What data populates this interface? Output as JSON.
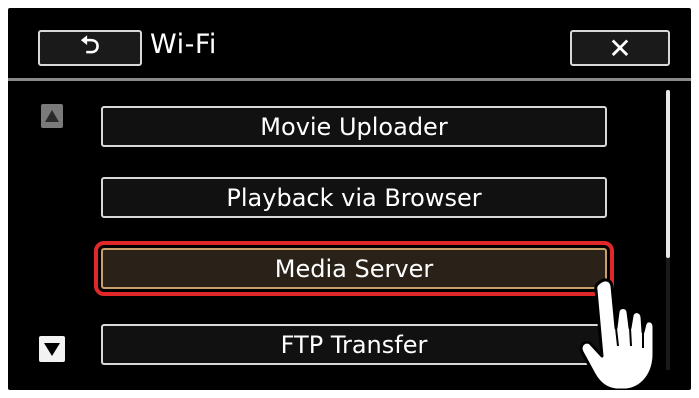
{
  "header": {
    "back_symbol": "⮌",
    "title": "Wi-Fi",
    "close_symbol": "✕"
  },
  "menu": {
    "items": [
      {
        "label": "Movie Uploader"
      },
      {
        "label": "Playback via Browser"
      },
      {
        "label": "Media Server",
        "selected": true
      },
      {
        "label": "FTP Transfer"
      }
    ]
  },
  "icons": {
    "back": "return-arrow-icon",
    "close": "close-icon",
    "scroll_up": "scroll-up-arrow-icon",
    "scroll_down": "scroll-down-arrow-icon",
    "pointer": "tapping-hand-icon"
  },
  "colors": {
    "background": "#000000",
    "button_border": "#d8d8d8",
    "selected_highlight": "#e0282a",
    "selected_inner_border": "#c9a06a"
  },
  "scroll": {
    "visible_fraction": 0.6
  }
}
